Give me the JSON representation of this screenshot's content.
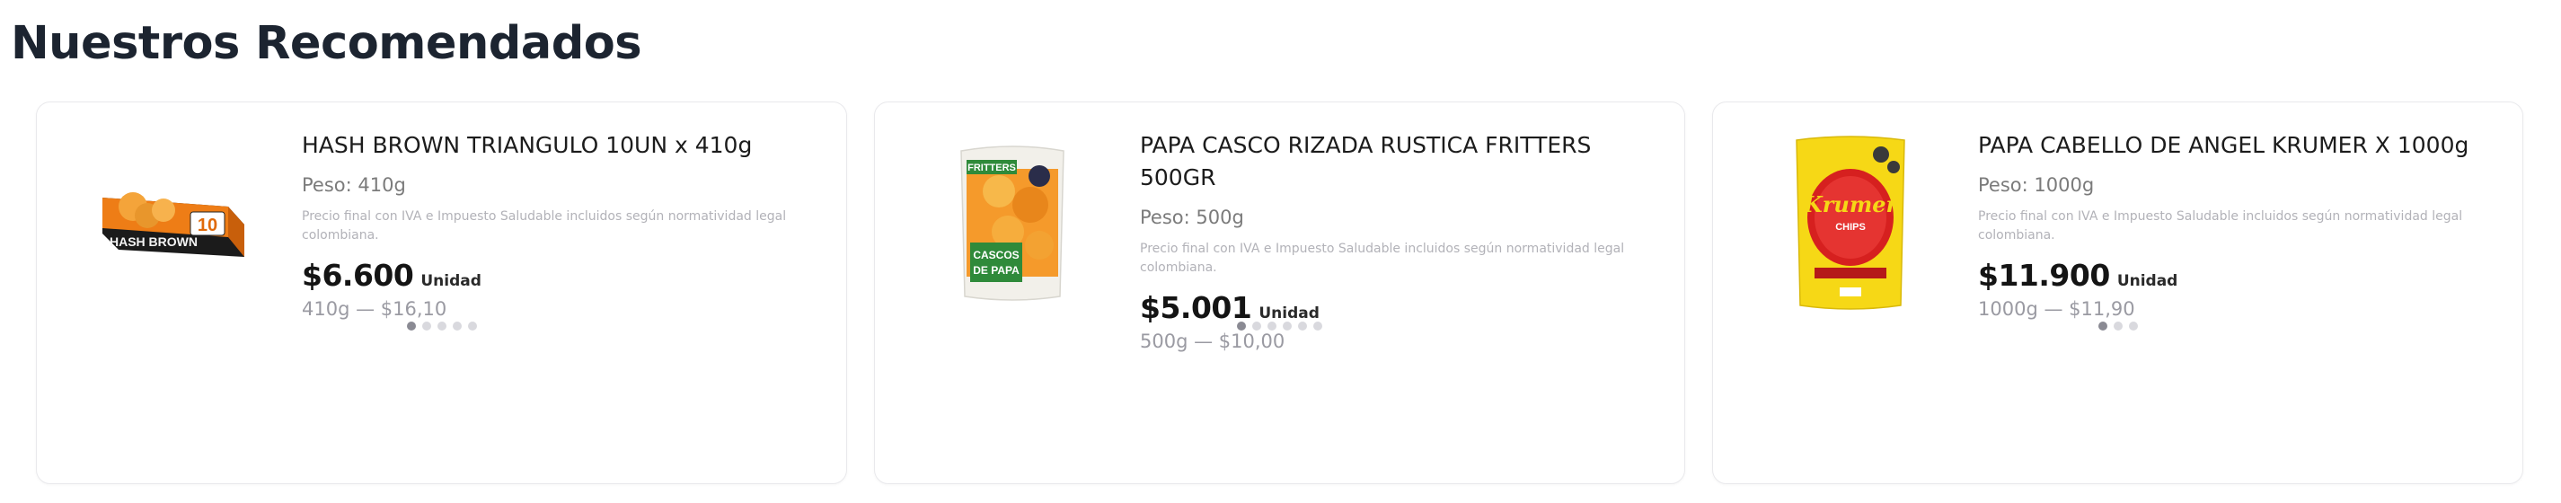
{
  "section": {
    "title": "Nuestros Recomendados"
  },
  "products": [
    {
      "name": "HASH BROWN TRIANGULO 10UN x 410g",
      "weight": "Peso: 410g",
      "note": "Precio final con IVA e Impuesto Saludable incluidos según normatividad legal colombiana.",
      "price": "$6.600",
      "unit": "Unidad",
      "unit_price": "410g — $16,10",
      "carousel_count": 5,
      "image_icon": "hash-brown-box"
    },
    {
      "name": "PAPA CASCO RIZADA RUSTICA FRITTERS 500GR",
      "weight": "Peso: 500g",
      "note": "Precio final con IVA e Impuesto Saludable incluidos según normatividad legal colombiana.",
      "price": "$5.001",
      "unit": "Unidad",
      "unit_price": "500g — $10,00",
      "carousel_count": 6,
      "image_icon": "fritters-bag"
    },
    {
      "name": "PAPA CABELLO DE ANGEL KRUMER X 1000g",
      "weight": "Peso: 1000g",
      "note": "Precio final con IVA e Impuesto Saludable incluidos según normatividad legal colombiana.",
      "price": "$11.900",
      "unit": "Unidad",
      "unit_price": "1000g — $11,90",
      "carousel_count": 3,
      "image_icon": "krumer-bag"
    }
  ],
  "image_text": {
    "hash_brown_box": {
      "brand": "HASH BROWN",
      "count": "10"
    },
    "fritters_bag": {
      "brand": "FRITTERS",
      "line1": "CASCOS",
      "line2": "DE PAPA"
    },
    "krumer_bag": {
      "brand": "Krumer",
      "sub": "CHIPS"
    }
  }
}
